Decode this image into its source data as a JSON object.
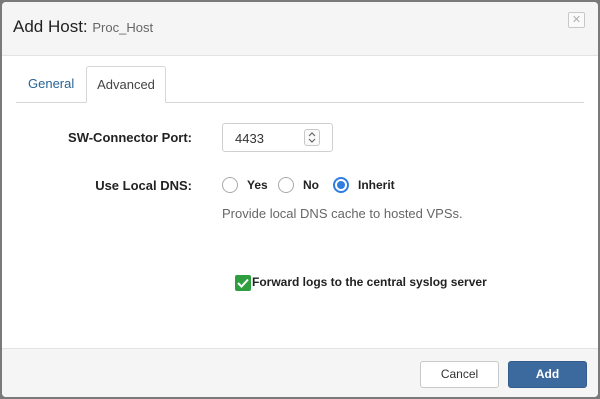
{
  "dialog": {
    "title": "Add Host:",
    "subtitle": "Proc_Host",
    "close_symbol": "✕"
  },
  "tabs": [
    {
      "label": "General",
      "active": false
    },
    {
      "label": "Advanced",
      "active": true
    }
  ],
  "form": {
    "port": {
      "label": "SW-Connector Port:",
      "value": "4433"
    },
    "dns": {
      "label": "Use Local DNS:",
      "options": [
        {
          "label": "Yes",
          "checked": false
        },
        {
          "label": "No",
          "checked": false
        },
        {
          "label": "Inherit",
          "checked": true
        }
      ],
      "help": "Provide local DNS cache to hosted VPSs."
    },
    "forward_logs": {
      "label": "Forward logs to the central syslog server",
      "checked": true
    }
  },
  "footer": {
    "cancel_label": "Cancel",
    "add_label": "Add"
  },
  "colors": {
    "accent": "#2f7de1",
    "primary_button": "#3d6a9e",
    "checkbox": "#2e9e3e",
    "tab_link": "#2a6496"
  }
}
